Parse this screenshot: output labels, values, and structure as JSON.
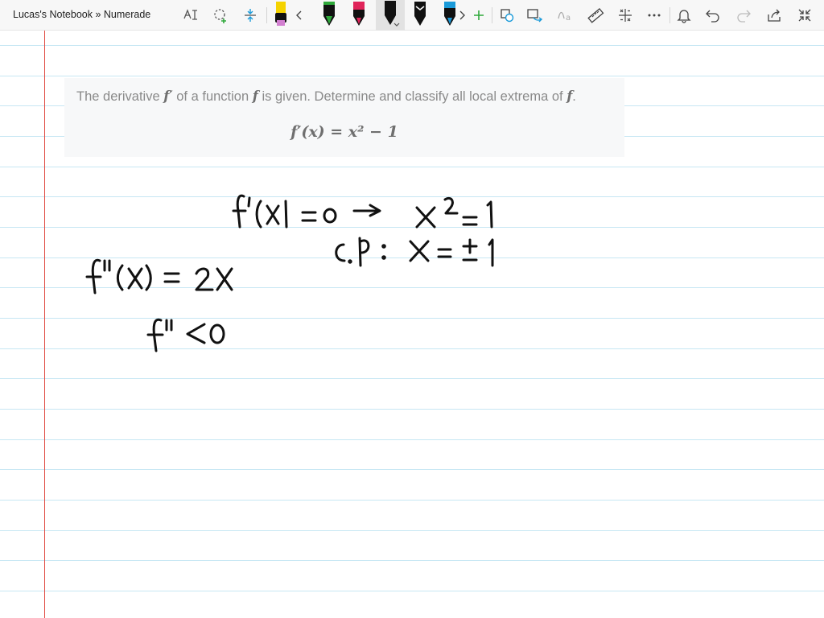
{
  "app": {
    "title": "Lucas's Notebook » Numerade"
  },
  "toolbar": {
    "tools": [
      "ink-to-text-icon",
      "lasso-select-icon",
      "add-space-icon"
    ],
    "pens": [
      "yellow-highlighter",
      "green-pen",
      "red-pen",
      "black-pen",
      "black-pen-2",
      "blue-pen"
    ],
    "pen_colors": {
      "highlighter": "#f0a5e0",
      "green": "#2ea83a",
      "red": "#e0245a",
      "black": "#111111",
      "blue": "#1a9ad9"
    },
    "right_tools": [
      "shape-icon",
      "ink-to-shape-icon",
      "ink-to-math-icon",
      "ruler-icon",
      "math-icon",
      "more-icon",
      "bell-icon",
      "undo-icon",
      "redo-icon",
      "share-icon",
      "fullscreen-icon"
    ]
  },
  "question": {
    "text_prefix": "The derivative ",
    "symbol_fprime": "f′",
    "text_mid": " of a function ",
    "symbol_f": "f",
    "text_suffix": " is given. Determine and classify all local extrema of ",
    "symbol_f_end": "f",
    "period": ".",
    "equation": "f′(x) = x² − 1"
  },
  "colors": {
    "accent_pen": "#111111",
    "margin": "#e0483f",
    "rules": "#c7e7f3"
  },
  "handwriting": [
    "f'(x) = 0 → x² = 1",
    "c.p: x = ±1",
    "f''(x) = 2x",
    "f'' < 0"
  ]
}
